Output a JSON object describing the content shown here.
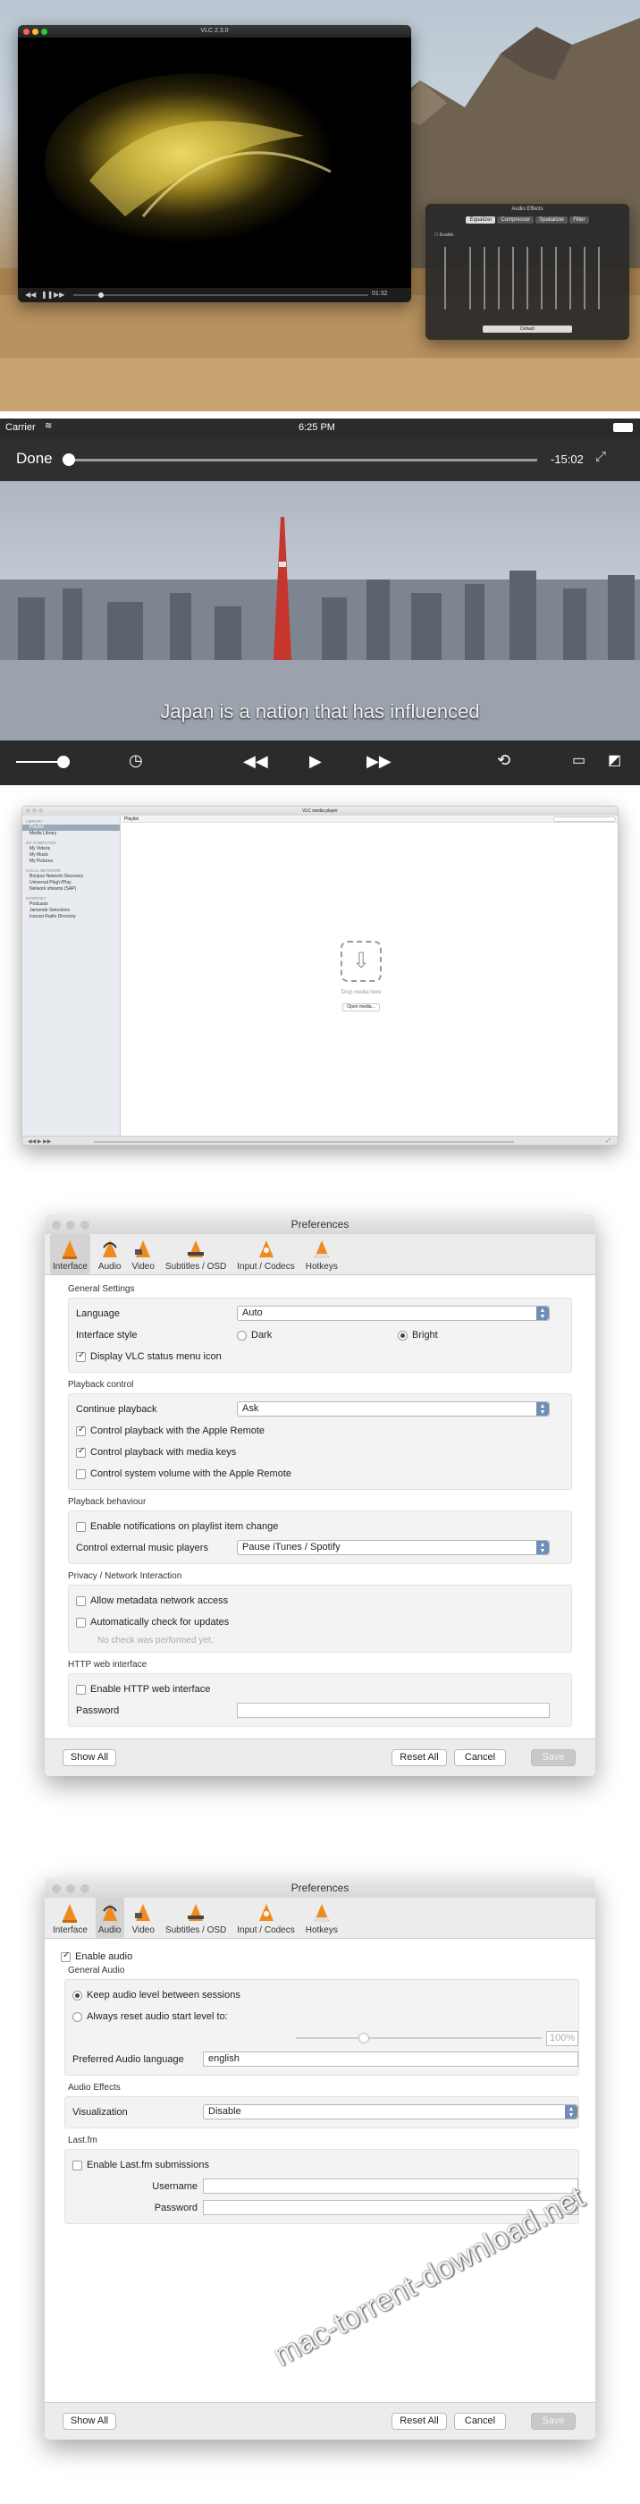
{
  "section1": {
    "player_title": "VLC 2.3.0",
    "player_time": "01:32",
    "effects": {
      "title": "Audio Effects",
      "tabs": [
        "Equalizer",
        "Compressor",
        "Spatializer",
        "Filter"
      ],
      "enable_label": "Enable",
      "preset": "Default"
    }
  },
  "section2": {
    "carrier": "Carrier",
    "clock": "6:25 PM",
    "done_label": "Done",
    "remaining": "-15:02",
    "subtitle": "Japan is a nation that has influenced"
  },
  "section3": {
    "window_title": "VLC media player",
    "playlist_header": "Playlist",
    "sidebar": {
      "library_head": "LIBRARY",
      "library_items": [
        "Playlist",
        "Media Library"
      ],
      "computer_head": "MY COMPUTER",
      "computer_items": [
        "My Videos",
        "My Music",
        "My Pictures"
      ],
      "devices_head": "LOCAL NETWORK",
      "devices_items": [
        "Bonjour Network Discovery",
        "Universal Plug'n'Play",
        "Network streams (SAP)"
      ],
      "internet_head": "INTERNET",
      "internet_items": [
        "Podcasts",
        "Jamendo Selections",
        "Icecast Radio Directory"
      ]
    },
    "drop_text": "Drop media here",
    "open_button": "Open media..."
  },
  "pref_tabs": [
    "Interface",
    "Audio",
    "Video",
    "Subtitles / OSD",
    "Input / Codecs",
    "Hotkeys"
  ],
  "pref1": {
    "title": "Preferences",
    "general_title": "General Settings",
    "language_label": "Language",
    "language_value": "Auto",
    "style_label": "Interface style",
    "style_dark": "Dark",
    "style_bright": "Bright",
    "status_icon": "Display VLC status menu icon",
    "playback_title": "Playback control",
    "continue_label": "Continue playback",
    "continue_value": "Ask",
    "apple_remote": "Control playback with the Apple Remote",
    "media_keys": "Control playback with media keys",
    "system_volume": "Control system volume with the Apple Remote",
    "behaviour_title": "Playback behaviour",
    "notifications": "Enable notifications on playlist item change",
    "external_label": "Control external music players",
    "external_value": "Pause iTunes / Spotify",
    "privacy_title": "Privacy / Network Interaction",
    "metadata": "Allow metadata network access",
    "updates": "Automatically check for updates",
    "no_check": "No check was performed yet.",
    "http_title": "HTTP web interface",
    "http_enable": "Enable HTTP web interface",
    "password_label": "Password",
    "show_all": "Show All",
    "reset_all": "Reset All",
    "cancel": "Cancel",
    "save": "Save"
  },
  "pref2": {
    "title": "Preferences",
    "enable_audio": "Enable audio",
    "general_title": "General Audio",
    "keep_level": "Keep audio level between sessions",
    "reset_level": "Always reset audio start level to:",
    "level_value": "100%",
    "preferred_label": "Preferred Audio language",
    "preferred_value": "english",
    "effects_title": "Audio Effects",
    "visualization_label": "Visualization",
    "visualization_value": "Disable",
    "lastfm_title": "Last.fm",
    "lastfm_enable": "Enable Last.fm submissions",
    "username_label": "Username",
    "password_label": "Password",
    "show_all": "Show All",
    "reset_all": "Reset All",
    "cancel": "Cancel",
    "save": "Save"
  },
  "watermark": "mac-torrent-download.net"
}
